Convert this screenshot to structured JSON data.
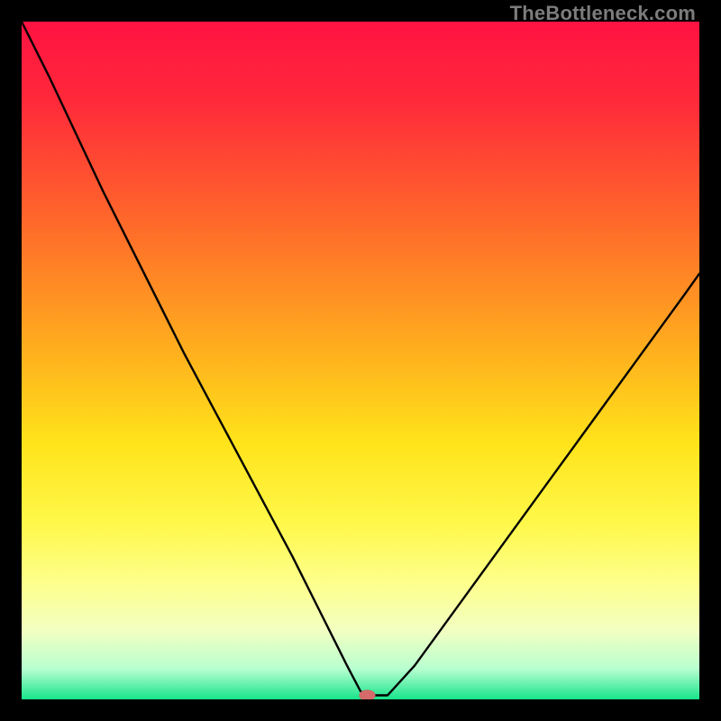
{
  "watermark": {
    "text": "TheBottleneck.com"
  },
  "chart_data": {
    "type": "line",
    "title": "",
    "xlabel": "",
    "ylabel": "",
    "xlim": [
      0,
      100
    ],
    "ylim": [
      0,
      100
    ],
    "grid": false,
    "legend": null,
    "background": {
      "type": "vertical-gradient",
      "stops": [
        {
          "offset": 0.0,
          "color": "#ff1242"
        },
        {
          "offset": 0.12,
          "color": "#ff2a3a"
        },
        {
          "offset": 0.3,
          "color": "#ff6a2a"
        },
        {
          "offset": 0.48,
          "color": "#ffad1e"
        },
        {
          "offset": 0.62,
          "color": "#ffe31a"
        },
        {
          "offset": 0.74,
          "color": "#fff84a"
        },
        {
          "offset": 0.83,
          "color": "#fdff8d"
        },
        {
          "offset": 0.9,
          "color": "#f1ffc2"
        },
        {
          "offset": 0.955,
          "color": "#b8ffd0"
        },
        {
          "offset": 1.0,
          "color": "#17e48b"
        }
      ]
    },
    "series": [
      {
        "name": "bottleneck-curve",
        "color": "#000000",
        "stroke_width": 2.4,
        "x": [
          0,
          4,
          8,
          12,
          16,
          20,
          24,
          28,
          32,
          36,
          40,
          44,
          46,
          48,
          50,
          51,
          52,
          54,
          58,
          62,
          66,
          70,
          74,
          78,
          82,
          86,
          90,
          94,
          98,
          100
        ],
        "y": [
          100,
          92,
          83.5,
          75,
          67,
          59,
          51,
          43.5,
          36,
          28.5,
          21,
          13,
          9,
          5,
          1.2,
          0.6,
          0.6,
          0.6,
          5,
          10.5,
          16,
          21.5,
          27,
          32.5,
          38,
          43.5,
          49,
          54.5,
          60,
          62.8
        ]
      }
    ],
    "marker": {
      "name": "optimal-point",
      "x": 51,
      "y": 0.6,
      "rx": 1.2,
      "ry": 0.8,
      "fill": "#d46a6a",
      "stroke": "#b24d4d"
    }
  }
}
